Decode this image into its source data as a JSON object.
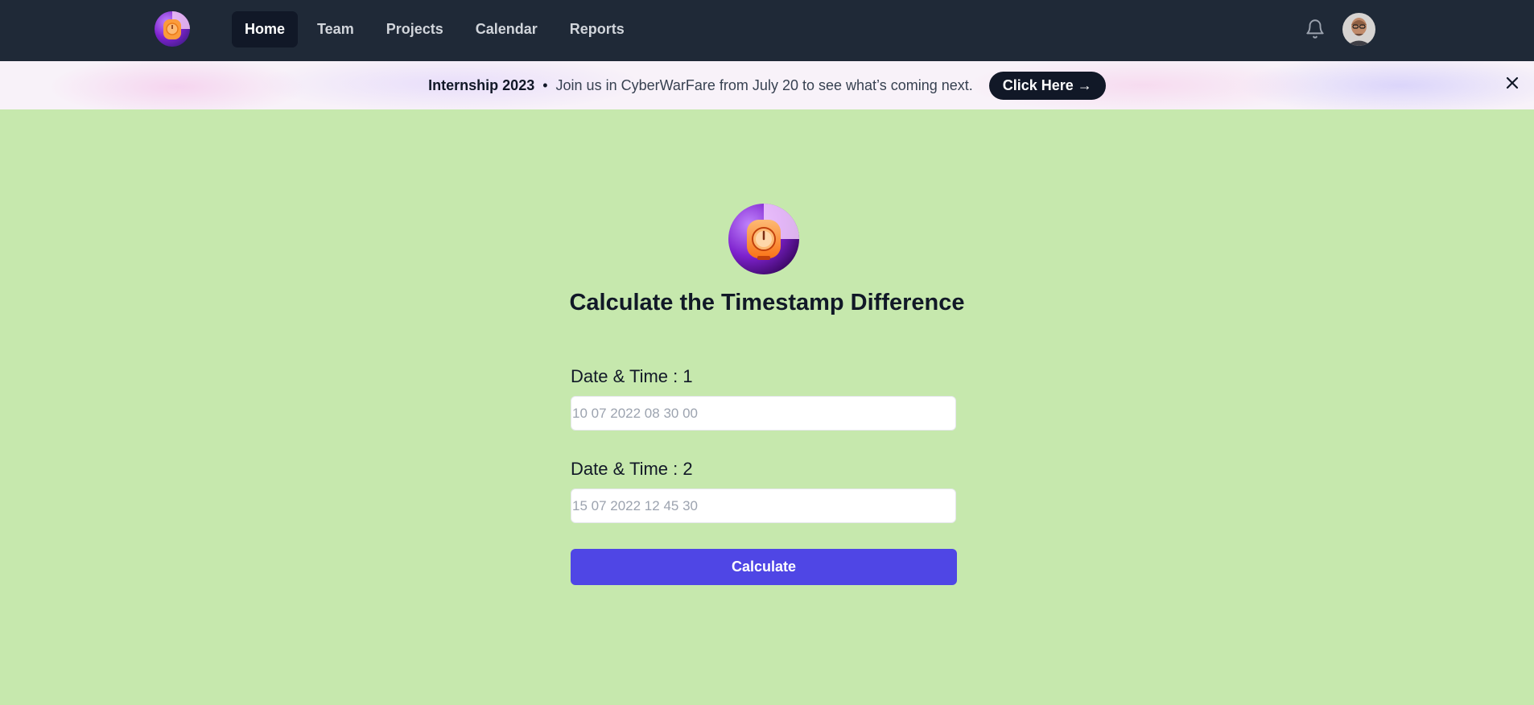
{
  "nav": {
    "items": [
      {
        "label": "Home",
        "active": true
      },
      {
        "label": "Team"
      },
      {
        "label": "Projects"
      },
      {
        "label": "Calendar"
      },
      {
        "label": "Reports"
      }
    ],
    "icons": {
      "logo": "timer-logo-icon",
      "notifications": "bell-icon",
      "user": "avatar"
    }
  },
  "banner": {
    "title": "Internship 2023",
    "separator": "•",
    "text": "Join us in CyberWarFare from July 20 to see what’s coming next.",
    "button": "Click Here →",
    "close_icon": "close-icon"
  },
  "main": {
    "title": "Calculate the Timestamp Difference",
    "field1": {
      "label": "Date & Time : 1",
      "placeholder": "10 07 2022 08 30 00",
      "value": ""
    },
    "field2": {
      "label": "Date & Time : 2",
      "placeholder": "15 07 2022 12 45 30",
      "value": ""
    },
    "button": "Calculate"
  },
  "colors": {
    "navbar": "#1f2937",
    "background": "#c6e8ad",
    "accent": "#4f46e5",
    "dark": "#111827"
  }
}
